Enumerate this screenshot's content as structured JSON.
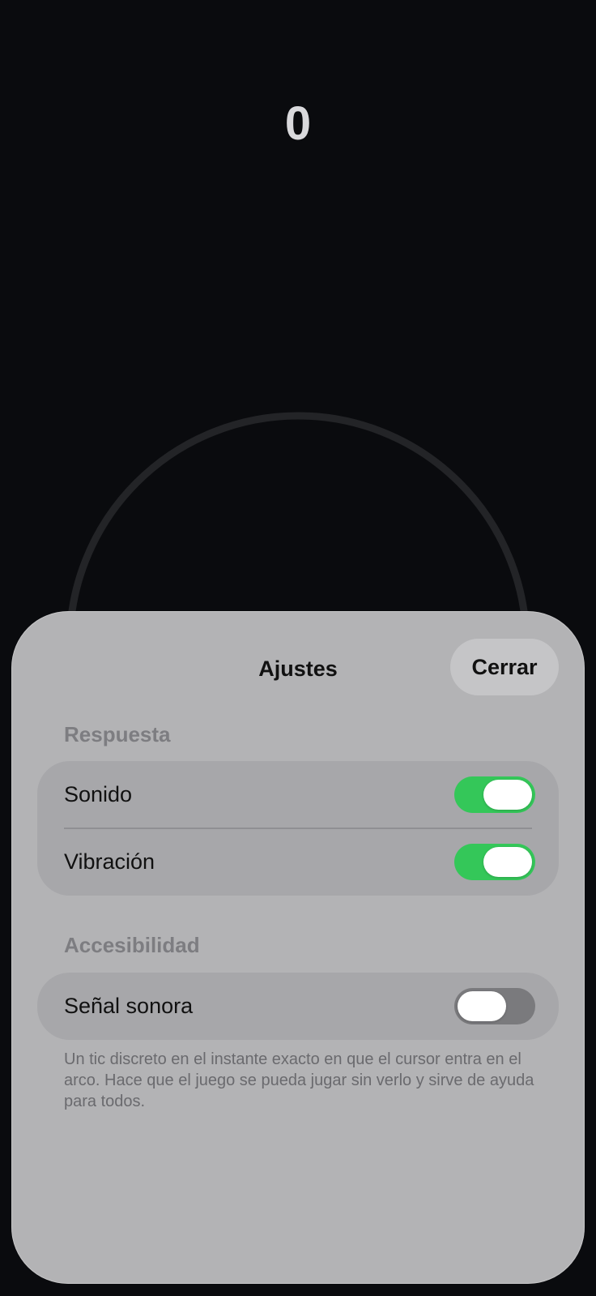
{
  "score": "0",
  "settings": {
    "title": "Ajustes",
    "close_label": "Cerrar",
    "sections": [
      {
        "header": "Respuesta",
        "items": [
          {
            "label": "Sonido",
            "enabled": true
          },
          {
            "label": "Vibración",
            "enabled": true
          }
        ]
      },
      {
        "header": "Accesibilidad",
        "items": [
          {
            "label": "Señal sonora",
            "enabled": false
          }
        ]
      }
    ],
    "footnote": "Un tic discreto en el instante exacto en que el cursor entra en el arco. Hace que el juego se pueda jugar sin verlo y sirve de ayuda para todos."
  },
  "colors": {
    "toggle_on": "#34c759",
    "toggle_off": "#7a7a7d",
    "background": "#0a0b0e",
    "sheet": "#b3b3b5"
  }
}
